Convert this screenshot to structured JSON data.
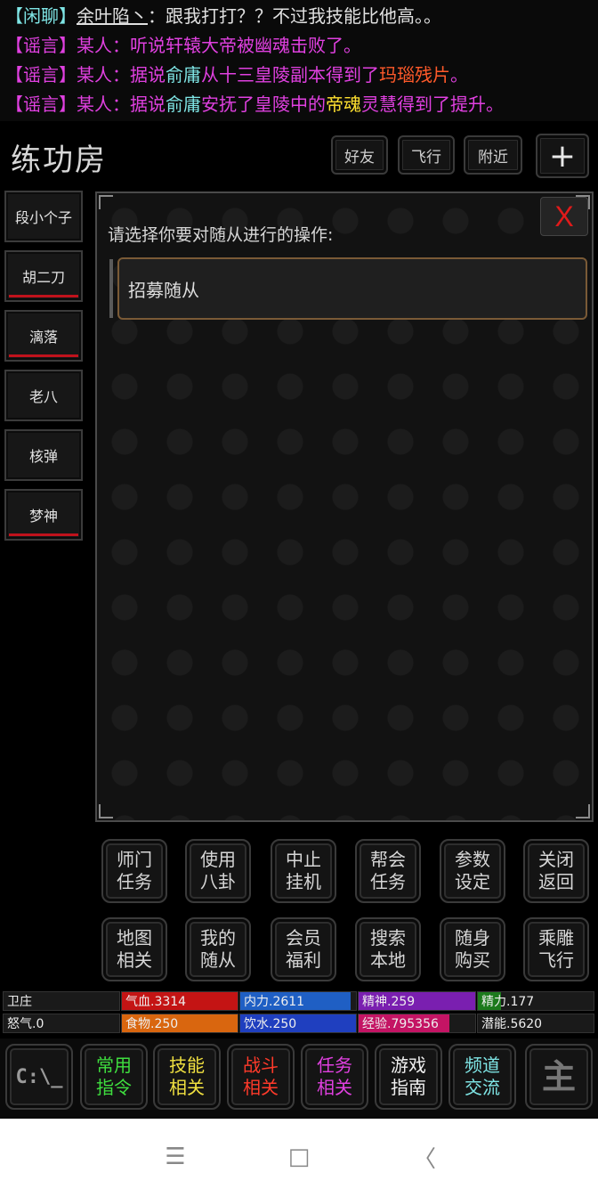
{
  "chat": [
    [
      {
        "t": "【闲聊】",
        "c": "#7fe6e6"
      },
      {
        "t": "余叶陷丶",
        "c": "#e0e0e0",
        "u": true
      },
      {
        "t": "：跟我打打？？不过我技能比他高。。",
        "c": "#e0e0e0"
      }
    ],
    [
      {
        "t": "【谣言】某人：听说轩辕大帝被幽魂击败了。",
        "c": "#e040e0"
      }
    ],
    [
      {
        "t": "【谣言】某人：据说",
        "c": "#e040e0"
      },
      {
        "t": "俞庸",
        "c": "#7fe6e6"
      },
      {
        "t": "从十三皇陵副本得到了",
        "c": "#e040e0"
      },
      {
        "t": "玛瑙残片",
        "c": "#ff5a2a"
      },
      {
        "t": "。",
        "c": "#e040e0"
      }
    ],
    [
      {
        "t": "【谣言】某人：据说",
        "c": "#e040e0"
      },
      {
        "t": "俞庸",
        "c": "#7fe6e6"
      },
      {
        "t": "安抚了皇陵中的",
        "c": "#e040e0"
      },
      {
        "t": "帝魂",
        "c": "#ffe030"
      },
      {
        "t": "灵慧得到了提升。",
        "c": "#e040e0"
      }
    ]
  ],
  "header": {
    "title": "练功房",
    "friends": "好友",
    "fly": "飞行",
    "nearby": "附近",
    "plus": "+"
  },
  "npcs": [
    {
      "name": "段小个子",
      "bar": false
    },
    {
      "name": "胡二刀",
      "bar": true
    },
    {
      "name": "漓落",
      "bar": true
    },
    {
      "name": "老八",
      "bar": false
    },
    {
      "name": "核弹",
      "bar": false
    },
    {
      "name": "梦神",
      "bar": true
    }
  ],
  "dialog": {
    "close": "X",
    "prompt": "请选择你要对随从进行的操作:",
    "recruit": "招募随从"
  },
  "commands": [
    "师门\n任务",
    "使用\n八卦",
    "中止\n挂机",
    "帮会\n任务",
    "参数\n设定",
    "关闭\n返回",
    "地图\n相关",
    "我的\n随从",
    "会员\n福利",
    "搜索\n本地",
    "随身\n购买",
    "乘雕\n飞行"
  ],
  "stats": [
    {
      "label": "卫庄",
      "fill": 0,
      "color": "#000000"
    },
    {
      "label": "气血.3314",
      "fill": 1.0,
      "color": "#c41414"
    },
    {
      "label": "内力.2611",
      "fill": 0.95,
      "color": "#1f5fc4"
    },
    {
      "label": "精神.259",
      "fill": 1.0,
      "color": "#7a1fb0"
    },
    {
      "label": "精力.177",
      "fill": 0.2,
      "color": "#1c7a1c"
    },
    {
      "label": "怒气.0",
      "fill": 0,
      "color": "#000000"
    },
    {
      "label": "食物.250",
      "fill": 1.0,
      "color": "#d9660f"
    },
    {
      "label": "饮水.250",
      "fill": 1.0,
      "color": "#1f3fbf"
    },
    {
      "label": "经验.795356",
      "fill": 0.78,
      "color": "#c41464"
    },
    {
      "label": "潜能.5620",
      "fill": 0,
      "color": "#000000"
    }
  ],
  "toolbar": [
    {
      "label": "C:\\_",
      "color": "#9a9a9a",
      "icon": "console-icon"
    },
    {
      "label": "常用\n指令",
      "color": "#3fdf3f"
    },
    {
      "label": "技能\n相关",
      "color": "#f0e040"
    },
    {
      "label": "战斗\n相关",
      "color": "#ff3a2a"
    },
    {
      "label": "任务\n相关",
      "color": "#e040e0"
    },
    {
      "label": "游戏\n指南",
      "color": "#f0f0f0"
    },
    {
      "label": "频道\n交流",
      "color": "#7fe6e6"
    },
    {
      "label": "主",
      "color": "#777777",
      "icon": "main-menu-icon"
    }
  ],
  "sysnav": {
    "menu": "☰",
    "home": "□",
    "back": "〈"
  }
}
